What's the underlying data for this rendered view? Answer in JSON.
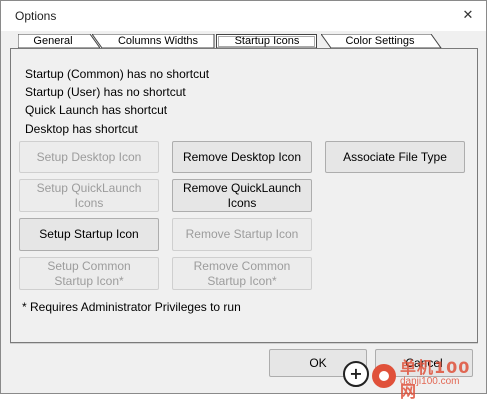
{
  "window": {
    "title": "Options",
    "close_symbol": "✕"
  },
  "tabs": [
    {
      "label": "General",
      "active": false
    },
    {
      "label": "Columns Widths",
      "active": false
    },
    {
      "label": "Startup Icons",
      "active": true
    },
    {
      "label": "Color Settings",
      "active": false
    }
  ],
  "status": [
    "Startup (Common) has no shortcut",
    "Startup (User) has no shortcut",
    "Quick Launch has shortcut",
    "Desktop has shortcut"
  ],
  "buttons": {
    "setup_desktop": {
      "label": "Setup Desktop Icon",
      "enabled": false
    },
    "remove_desktop": {
      "label": "Remove Desktop Icon",
      "enabled": true
    },
    "associate": {
      "label": "Associate File Type",
      "enabled": true
    },
    "setup_quicklaunch": {
      "label": "Setup QuickLaunch Icons",
      "enabled": false
    },
    "remove_quicklaunch": {
      "label": "Remove QuickLaunch Icons",
      "enabled": true
    },
    "setup_startup": {
      "label": "Setup Startup Icon",
      "enabled": true
    },
    "remove_startup": {
      "label": "Remove Startup Icon",
      "enabled": false
    },
    "setup_common": {
      "label": "Setup Common Startup Icon*",
      "enabled": false
    },
    "remove_common": {
      "label": "Remove Common Startup Icon*",
      "enabled": false
    },
    "ok": {
      "label": "OK",
      "enabled": true
    },
    "cancel": {
      "label": "Cancel",
      "enabled": true
    }
  },
  "note": "* Requires Administrator Privileges to run",
  "watermark": {
    "text1": "单机100网",
    "text2": "danji100.com",
    "colors": [
      "#e0513a",
      "#222222"
    ]
  }
}
